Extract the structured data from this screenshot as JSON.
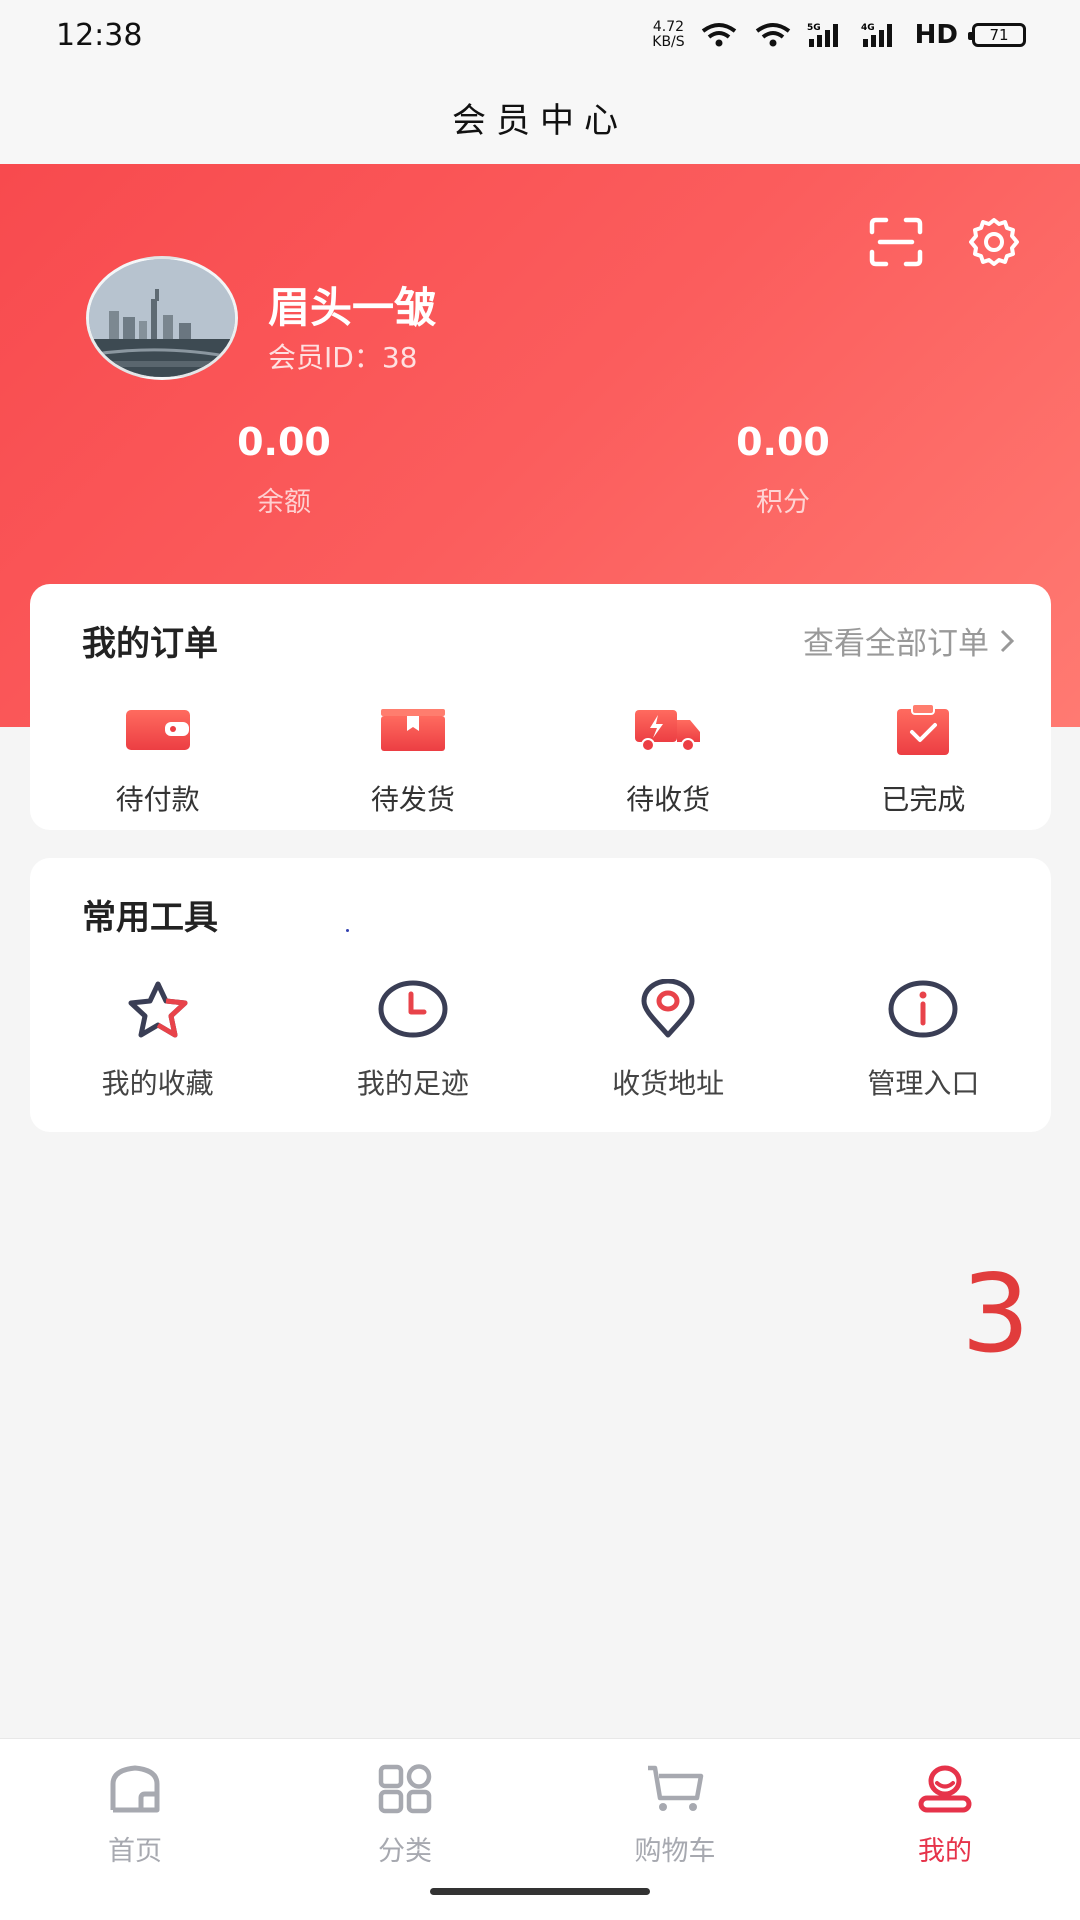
{
  "status_bar": {
    "time": "12:38",
    "net_speed_value": "4.72",
    "net_speed_unit": "KB/S",
    "signal_5g": "5G",
    "signal_4g": "4G",
    "hd": "HD",
    "battery": "71"
  },
  "header": {
    "title": "会员中心"
  },
  "profile": {
    "name": "眉头一皱",
    "member_id": "会员ID：38",
    "balance_value": "0.00",
    "balance_label": "余额",
    "points_value": "0.00",
    "points_label": "积分"
  },
  "orders": {
    "title": "我的订单",
    "view_all": "查看全部订单",
    "items": [
      {
        "label": "待付款",
        "icon": "wallet-icon"
      },
      {
        "label": "待发货",
        "icon": "box-icon"
      },
      {
        "label": "待收货",
        "icon": "truck-icon"
      },
      {
        "label": "已完成",
        "icon": "clipboard-check-icon"
      }
    ]
  },
  "tools": {
    "title": "常用工具",
    "items": [
      {
        "label": "我的收藏",
        "icon": "star-icon"
      },
      {
        "label": "我的足迹",
        "icon": "clock-icon"
      },
      {
        "label": "收货地址",
        "icon": "location-pin-icon"
      },
      {
        "label": "管理入口",
        "icon": "info-icon"
      }
    ]
  },
  "overlay_number": "3",
  "bottom_nav": {
    "items": [
      {
        "label": "首页",
        "icon": "home-icon",
        "active": false
      },
      {
        "label": "分类",
        "icon": "grid-icon",
        "active": false
      },
      {
        "label": "购物车",
        "icon": "cart-icon",
        "active": false
      },
      {
        "label": "我的",
        "icon": "user-icon",
        "active": true
      }
    ]
  },
  "colors": {
    "brand_red": "#f84a4e",
    "active_nav": "#e6334a",
    "icon_dark": "#3a3e55"
  }
}
